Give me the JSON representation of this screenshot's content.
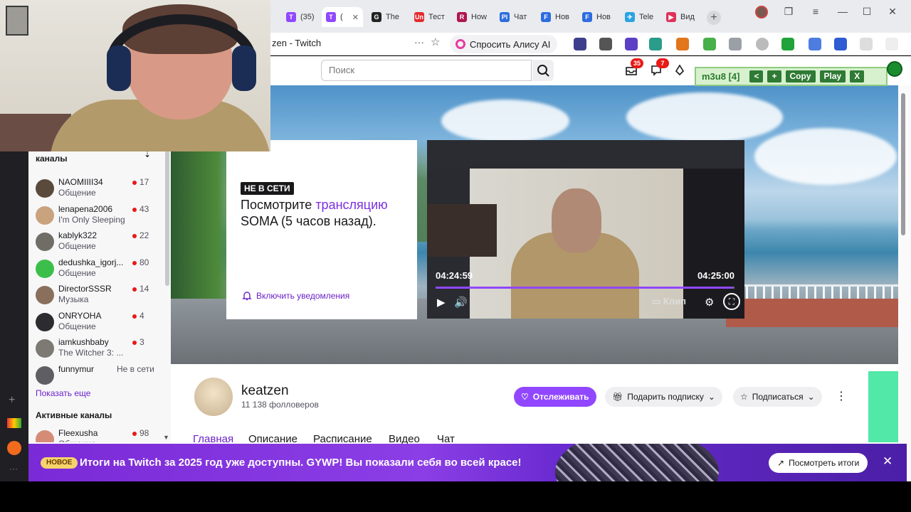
{
  "browser": {
    "tabs": [
      {
        "label": "(35)",
        "color": "#9147ff",
        "glyph": "T"
      },
      {
        "label": "(",
        "color": "#9147ff",
        "glyph": "T",
        "active": true
      },
      {
        "label": "The",
        "color": "#222222",
        "glyph": "G"
      },
      {
        "label": "Тест",
        "color": "#e52b2b",
        "glyph": "Un"
      },
      {
        "label": "How",
        "color": "#b0154b",
        "glyph": "R"
      },
      {
        "label": "Чат",
        "color": "#2d6cdf",
        "glyph": "Pl"
      },
      {
        "label": "Нов",
        "color": "#2d6cdf",
        "glyph": "F"
      },
      {
        "label": "Нов",
        "color": "#2d6cdf",
        "glyph": "F"
      },
      {
        "label": "Tele",
        "color": "#2aa3e0",
        "glyph": "✈"
      },
      {
        "label": "Вид",
        "color": "#e0315a",
        "glyph": "▶"
      }
    ],
    "address_title": "zen - Twitch",
    "alice_label": "Спросить Алису AI"
  },
  "twitch": {
    "search_placeholder": "Поиск",
    "inbox_badge": "35",
    "whispers_badge": "7",
    "offline": {
      "tag": "НЕ В СЕТИ",
      "text_before": "Посмотрите ",
      "text_link": "трансляцию",
      "text_after": " SOMA (5 часов назад).",
      "notify_label": "Включить уведомления"
    },
    "player": {
      "time_left": "04:24:59",
      "time_right": "04:25:00",
      "progress": 0.995,
      "clip_label": "Клип"
    },
    "sidebar": {
      "heading": "каналы",
      "channels": [
        {
          "name": "NAOMIIII34",
          "category": "Общение",
          "viewers": "17",
          "avatar": "#5a4a3c"
        },
        {
          "name": "lenapena2006",
          "category": "I'm Only Sleeping",
          "viewers": "43",
          "avatar": "#c9a27e"
        },
        {
          "name": "kablyk322",
          "category": "Общение",
          "viewers": "22",
          "avatar": "#6f6d66"
        },
        {
          "name": "dedushka_igorj...",
          "category": "Общение",
          "viewers": "80",
          "avatar": "#3cbf4a"
        },
        {
          "name": "DirectorSSSR",
          "category": "Музыка",
          "viewers": "14",
          "avatar": "#8a6f5c"
        },
        {
          "name": "ONRYOHA",
          "category": "Общение",
          "viewers": "4",
          "avatar": "#2c2c30"
        },
        {
          "name": "iamkushbaby",
          "category": "The Witcher 3: ...",
          "viewers": "3",
          "avatar": "#7d7a74"
        },
        {
          "name": "funnymur",
          "category": "",
          "offline": "Не в сети",
          "avatar": "#5f5f63"
        }
      ],
      "show_more": "Показать еще",
      "active_heading": "Активные каналы",
      "active_channels": [
        {
          "name": "Fleexusha",
          "category": "Общение",
          "viewers": "98",
          "avatar": "#d58c77"
        }
      ]
    },
    "channel": {
      "name": "keatzen",
      "followers": "11 138 фолловеров",
      "follow_label": "Отслеживать",
      "gift_label": "Подарить подписку",
      "subscribe_label": "Подписаться",
      "tabs": [
        "Главная",
        "Описание",
        "Расписание",
        "Видео",
        "Чат"
      ]
    },
    "banner": {
      "tag": "НОВОЕ",
      "text": "Итоги на Twitch за 2025 год уже доступны. GYWP! Вы показали себя во всей красе!",
      "button": "Посмотреть итоги"
    }
  },
  "m3u8": {
    "label": "m3u8 [4]",
    "buttons": [
      "<",
      "+",
      "Copy",
      "Play",
      "X"
    ]
  }
}
